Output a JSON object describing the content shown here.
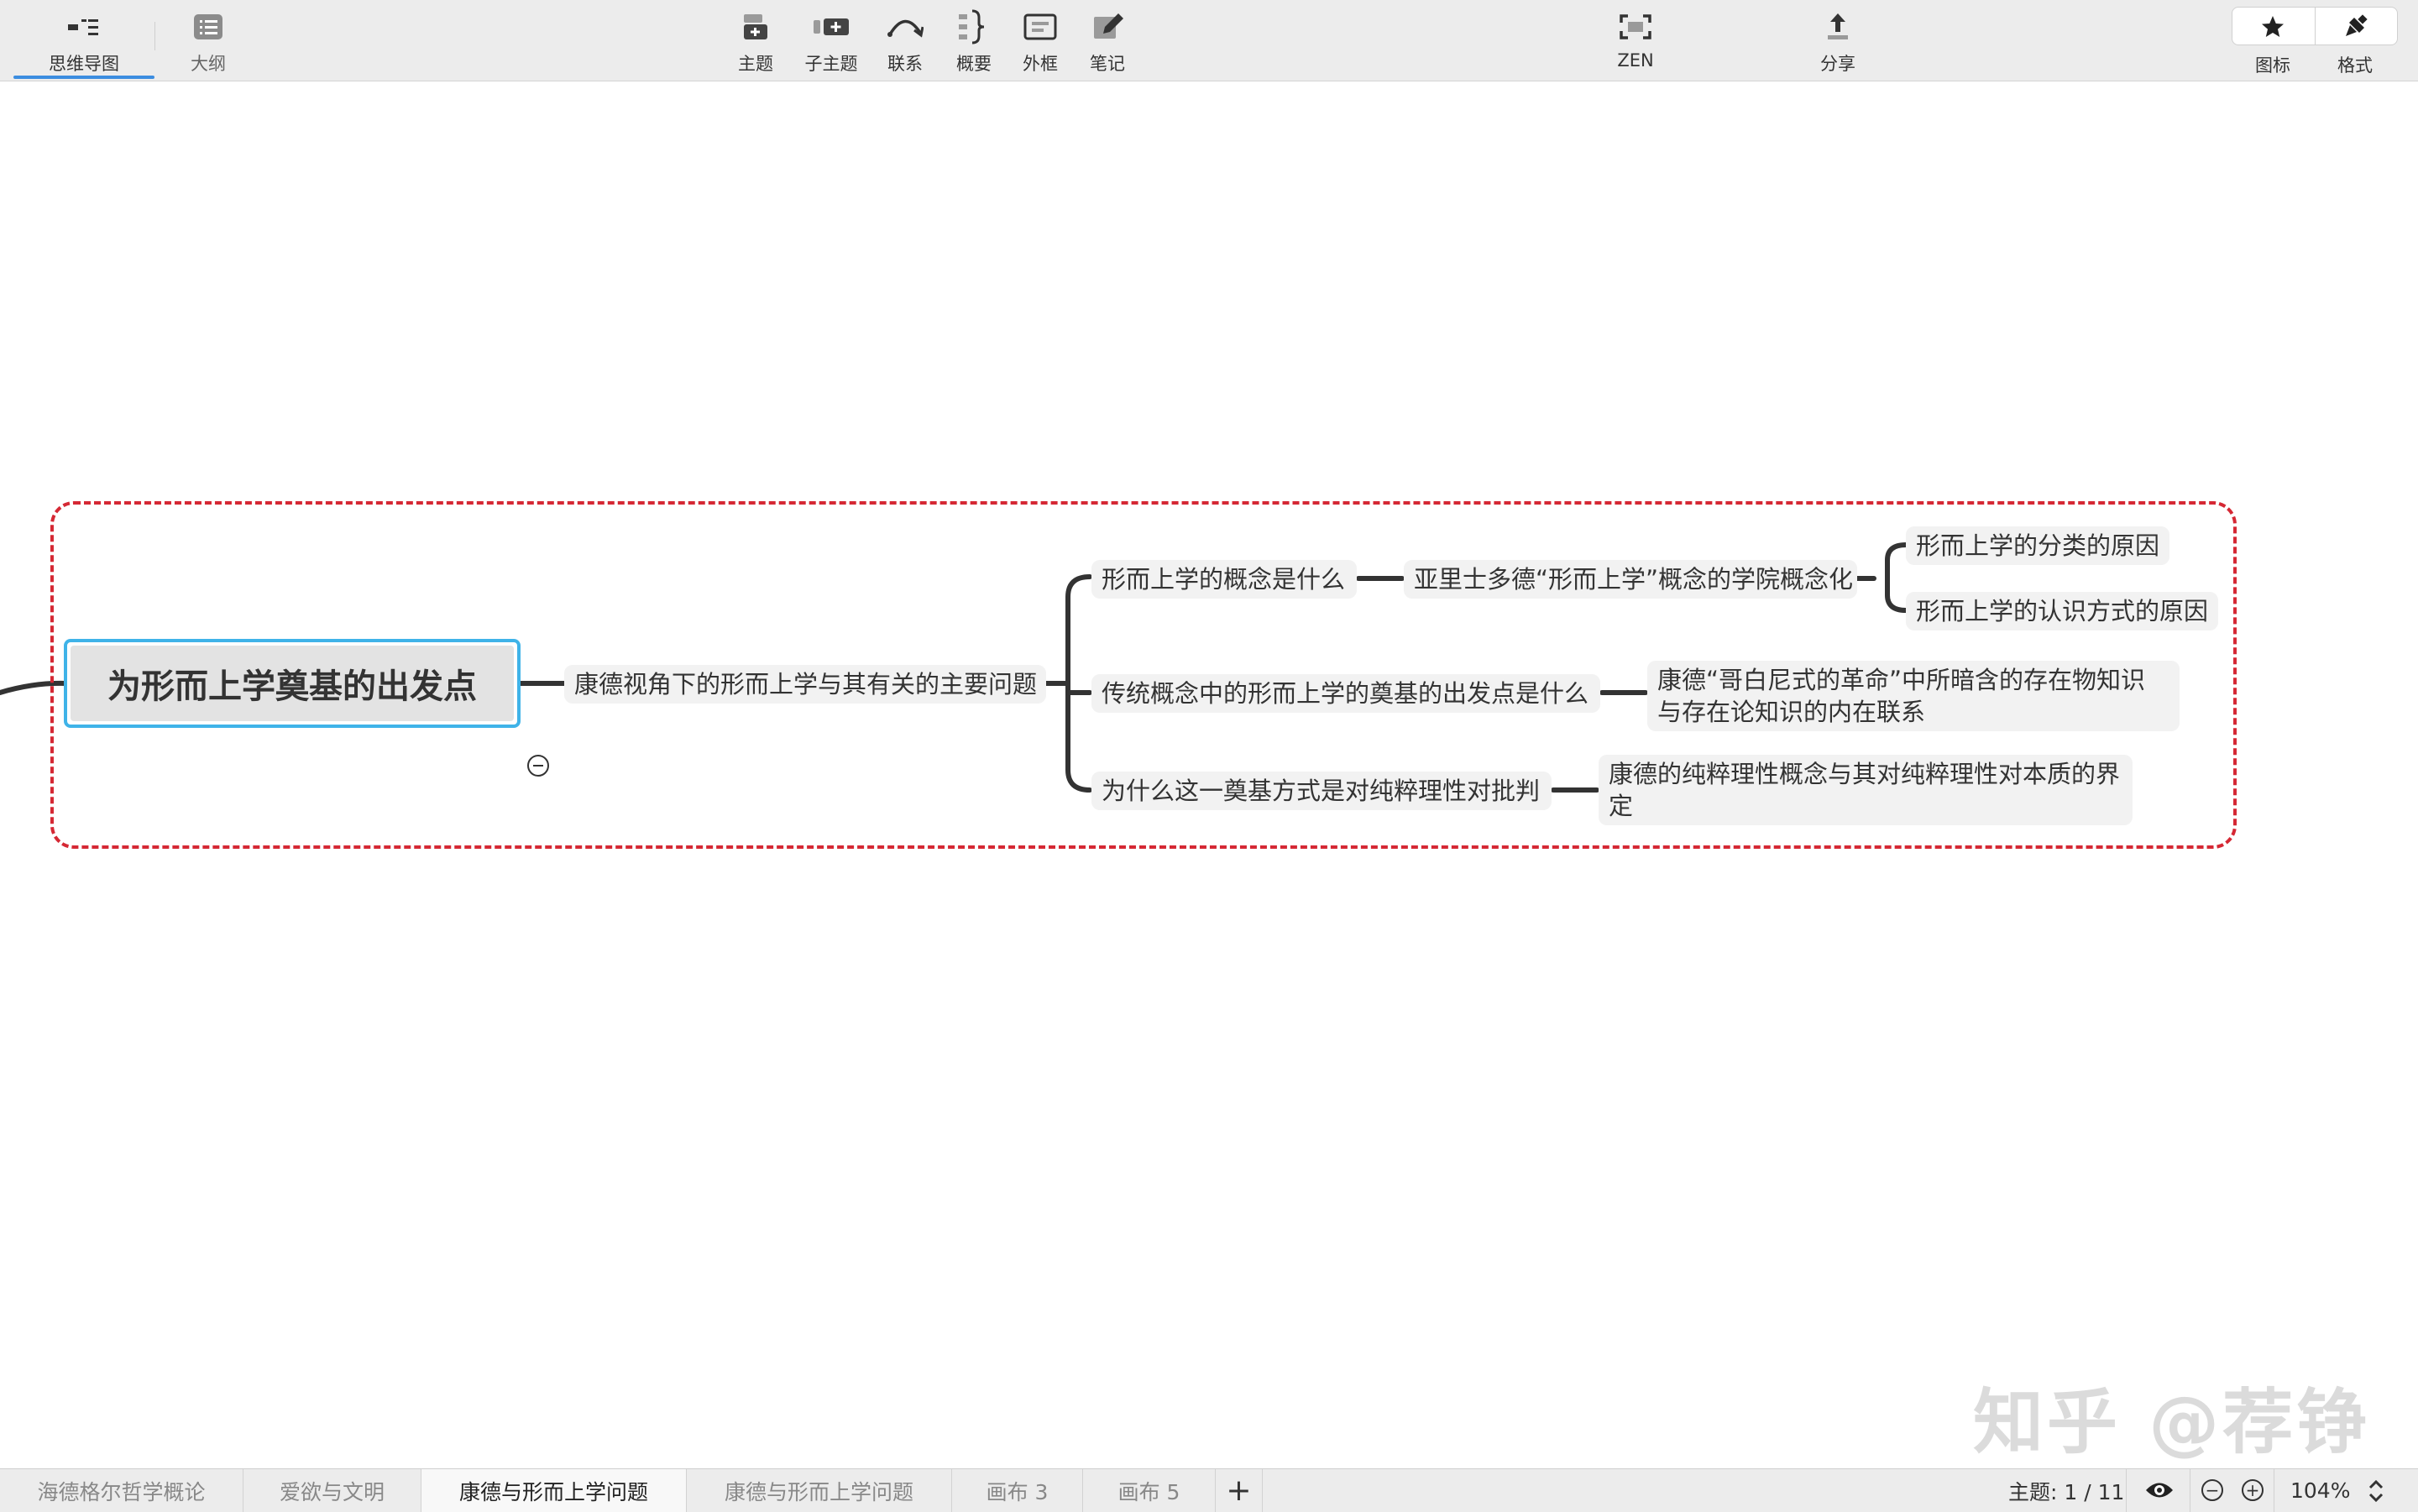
{
  "toolbar": {
    "left_tabs": [
      {
        "label": "思维导图",
        "icon": "mindmap-icon",
        "active": true
      },
      {
        "label": "大纲",
        "icon": "outline-list-icon",
        "active": false
      }
    ],
    "insert": [
      {
        "label": "主题",
        "icon": "topic-icon"
      },
      {
        "label": "子主题",
        "icon": "subtopic-icon"
      },
      {
        "label": "联系",
        "icon": "relationship-icon"
      },
      {
        "label": "概要",
        "icon": "summary-brace-icon"
      },
      {
        "label": "外框",
        "icon": "boundary-icon"
      },
      {
        "label": "笔记",
        "icon": "note-icon"
      }
    ],
    "zen": {
      "label": "ZEN",
      "icon": "zen-fullscreen-icon"
    },
    "share": {
      "label": "分享",
      "icon": "share-icon"
    },
    "right": [
      {
        "label": "图标",
        "icon": "star-icon"
      },
      {
        "label": "格式",
        "icon": "format-brush-icon"
      }
    ]
  },
  "mindmap": {
    "central": "为形而上学奠基的出发点",
    "level1": "康德视角下的形而上学与其有关的主要问题",
    "q1": "形而上学的概念是什么",
    "q1_child": "亚里士多德“形而上学”概念的学院概念化",
    "q1_leaf1": "形而上学的分类的原因",
    "q1_leaf2": "形而上学的认识方式的原因",
    "q2": "传统概念中的形而上学的奠基的出发点是什么",
    "q2_child": "康德“哥白尼式的革命”中所暗含的存在物知识与存在论知识的内在联系",
    "q3": "为什么这一奠基方式是对纯粹理性对批判",
    "q3_child": "康德的纯粹理性概念与其对纯粹理性对本质的界定",
    "boundary_color": "#d52834",
    "selection_color": "#3fb3e8"
  },
  "watermark": "知乎 @荐铮",
  "tabs": [
    {
      "label": "海德格尔哲学概论",
      "active": false
    },
    {
      "label": "爱欲与文明",
      "active": false
    },
    {
      "label": "康德与形而上学问题",
      "active": true
    },
    {
      "label": "康德与形而上学问题",
      "active": false
    },
    {
      "label": "画布 3",
      "active": false
    },
    {
      "label": "画布 5",
      "active": false
    }
  ],
  "add_tab": "+",
  "status": {
    "topic_count": "主题: 1 / 11",
    "zoom": "104%",
    "zoom_out": "−",
    "zoom_in": "+"
  }
}
